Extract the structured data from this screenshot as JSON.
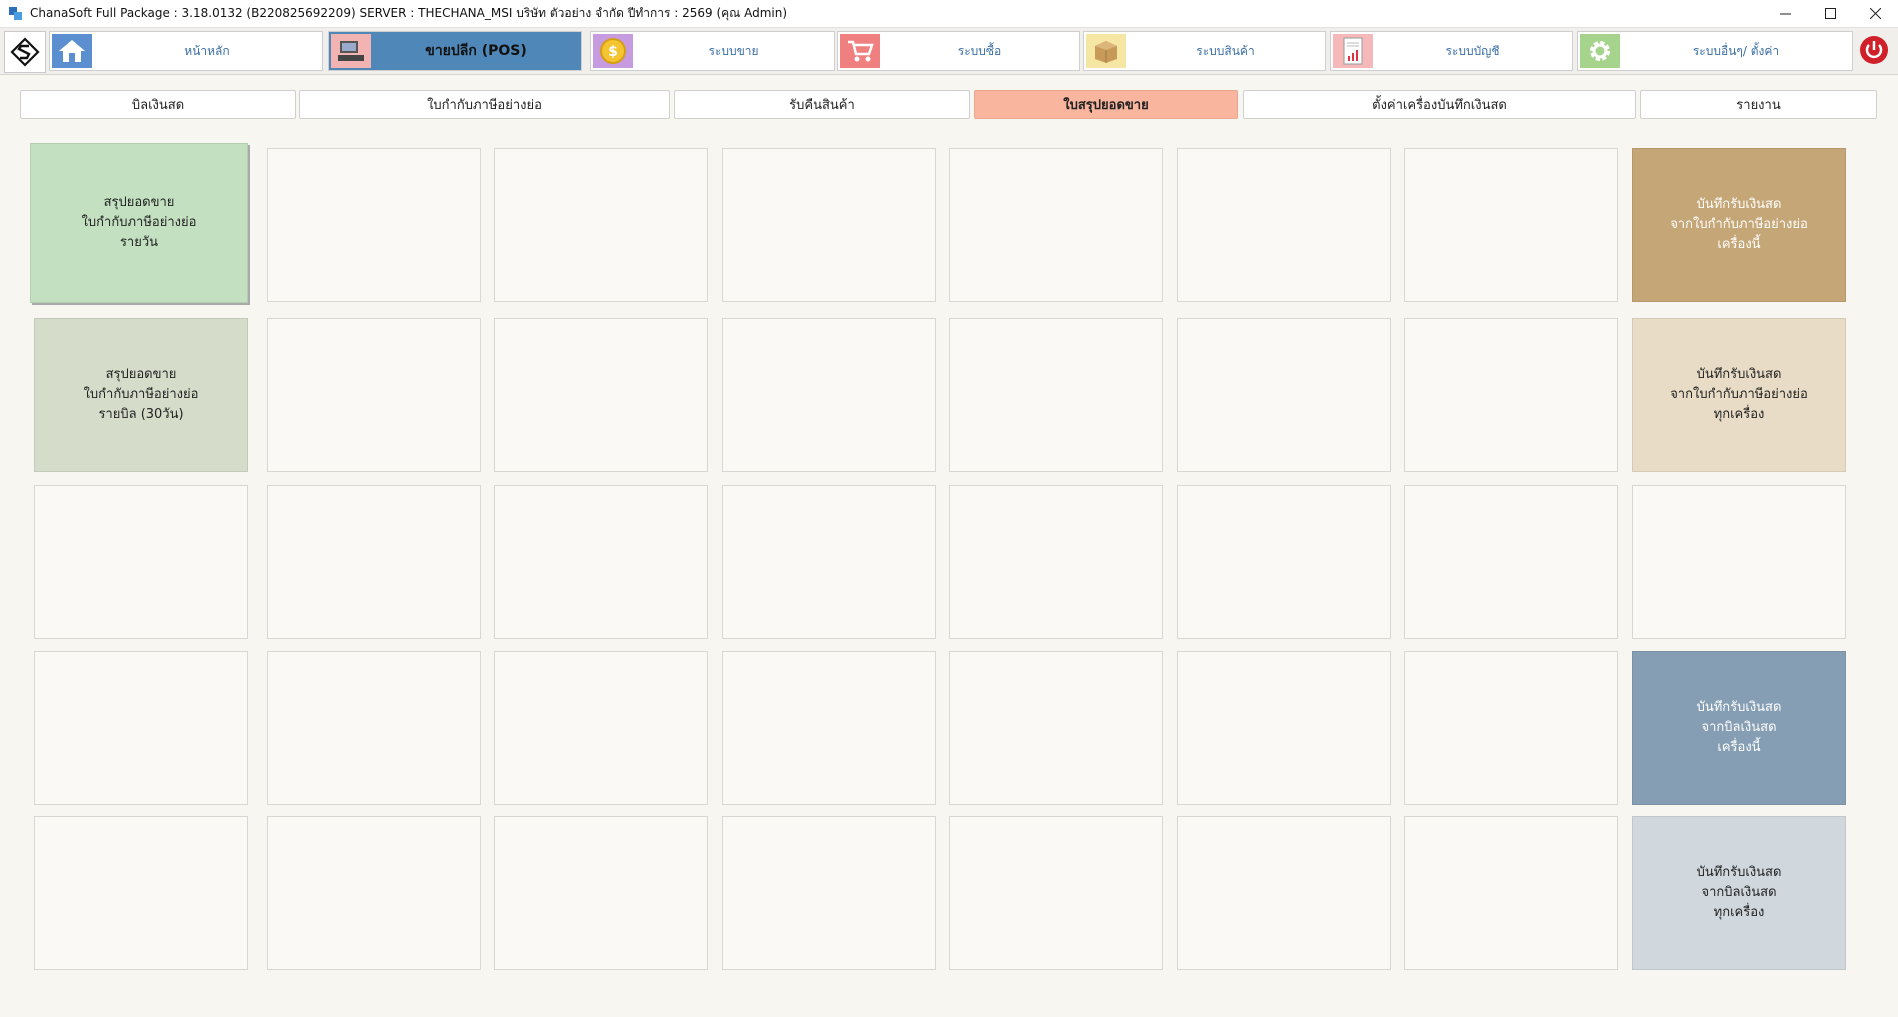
{
  "window": {
    "title": "ChanaSoft Full Package : 3.18.0132 (B220825692209) SERVER : THECHANA_MSI บริษัท ตัวอย่าง จำกัด ปีทำการ : 2569 (คุณ Admin)"
  },
  "modules": [
    {
      "label": "หน้าหลัก",
      "icon": "home-icon",
      "color": "#5b8fd0"
    },
    {
      "label": "ขายปลีก (POS)",
      "icon": "pos-terminal-icon",
      "color": "#f2b3b3"
    },
    {
      "label": "ระบบขาย",
      "icon": "coin-icon",
      "color": "#c79be0"
    },
    {
      "label": "ระบบซื้อ",
      "icon": "cart-icon",
      "color": "#f07f7f"
    },
    {
      "label": "ระบบสินค้า",
      "icon": "box-icon",
      "color": "#f6e6a3"
    },
    {
      "label": "ระบบบัญชี",
      "icon": "report-icon",
      "color": "#f5b9b9"
    },
    {
      "label": "ระบบอื่นๆ/ ตั้งค่า",
      "icon": "gear-icon",
      "color": "#a7d48c"
    }
  ],
  "tabs": [
    {
      "label": "บิลเงินสด"
    },
    {
      "label": "ใบกำกับภาษีอย่างย่อ"
    },
    {
      "label": "รับคืนสินค้า"
    },
    {
      "label": "ใบสรุปยอดขาย"
    },
    {
      "label": "ตั้งค่าเครื่องบันทึกเงินสด"
    },
    {
      "label": "รายงาน"
    }
  ],
  "tiles": {
    "daily_summary": "สรุปยอดขาย\nใบกำกับภาษีอย่างย่อ\nรายวัน",
    "bill_summary_30": "สรุปยอดขาย\nใบกำกับภาษีอย่างย่อ\nรายบิล (30วัน)",
    "cash_tax_this": "บันทึกรับเงินสด\nจากใบกำกับภาษีอย่างย่อ\nเครื่องนี้",
    "cash_tax_all": "บันทึกรับเงินสด\nจากใบกำกับภาษีอย่างย่อ\nทุกเครื่อง",
    "cash_bill_this": "บันทึกรับเงินสด\nจากบิลเงินสด\nเครื่องนี้",
    "cash_bill_all": "บันทึกรับเงินสด\nจากบิลเงินสด\nทุกเครื่อง"
  },
  "colors": {
    "tile_green": "#c3e0c1",
    "tile_sage": "#d5dcc9",
    "tile_tan": "#c5a677",
    "tile_beige": "#e8dcc6",
    "tile_slate": "#869eb4",
    "tile_grey_blue": "#d0d8dd",
    "active_tab": "#f9b59e",
    "active_module": "#4f88b8"
  }
}
